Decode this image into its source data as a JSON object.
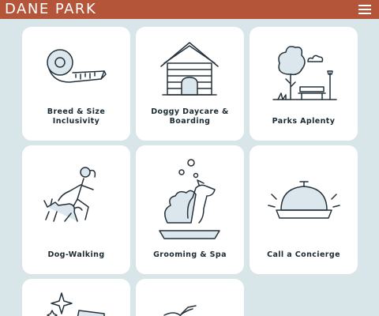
{
  "header": {
    "brand": "DANE PARK",
    "menu_icon": "hamburger-menu-icon",
    "background": "#b4553a"
  },
  "cards": [
    {
      "label": "Breed & Size Inclusivity",
      "icon": "tape-measure-icon"
    },
    {
      "label": "Doggy Daycare & Boarding",
      "icon": "dog-house-icon"
    },
    {
      "label": "Parks Aplenty",
      "icon": "park-bench-icon"
    },
    {
      "label": "Dog-Walking",
      "icon": "dog-walker-icon"
    },
    {
      "label": "Grooming & Spa",
      "icon": "dog-bath-icon"
    },
    {
      "label": "Call a Concierge",
      "icon": "service-bell-icon"
    },
    {
      "label": "",
      "icon": "sparkle-cleaning-icon"
    },
    {
      "label": "",
      "icon": "bird-icon"
    }
  ],
  "colors": {
    "page_background": "#d8e5e9",
    "card_background": "#ffffff",
    "icon_accent": "#dbe7ec",
    "text": "#1b2a33"
  }
}
